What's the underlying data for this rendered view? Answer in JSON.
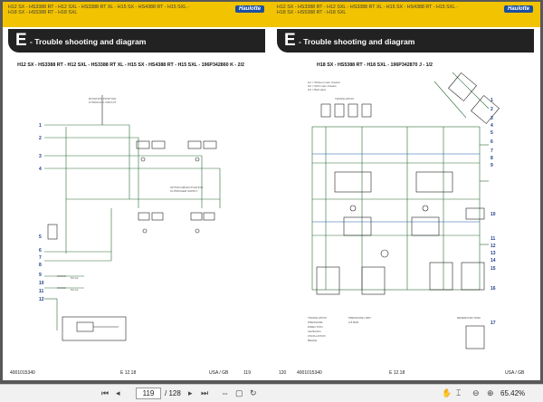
{
  "left_page": {
    "header_lines": [
      "H12 SX - HS3388 RT - H12 SXL - HS3388 RT XL - H15 SX - HS4388 RT - H15 SXL -",
      "H18 SX - HS5388 RT - H18 SXL"
    ],
    "logo": "Haulotte",
    "title_letter": "E",
    "title_text": "- Trouble shooting and diagram",
    "diagram_title": "H12 SX - HS3388 RT - H12 SXL - HS3388 RT XL - H15 SX - HS4388 RT - H15 SXL - 196P342860 K - 2/2",
    "row_numbers": [
      "1",
      "2",
      "3",
      "4",
      "5",
      "6",
      "7",
      "8",
      "9",
      "10",
      "11",
      "12"
    ],
    "footer": {
      "doc_number": "4001015340",
      "edition": "E 12.18",
      "lang": "USA / GB",
      "page": "119"
    }
  },
  "right_page": {
    "header_lines": [
      "H12 SX - HS3388 RT - H12 SXL - HS3388 RT XL - H15 SX - HS4388 RT - H15 SXL -",
      "H18 SX - HS5388 RT - H18 SXL"
    ],
    "logo": "Haulotte",
    "title_letter": "E",
    "title_text": "- Trouble shooting and diagram",
    "diagram_title": "H18 SX - HS5388 RT - H18 SXL - 196P342870 J - 1/2",
    "row_numbers": [
      "1",
      "2",
      "3",
      "4",
      "5",
      "6",
      "7",
      "8",
      "9",
      "10",
      "11",
      "12",
      "13",
      "14",
      "15",
      "16",
      "17"
    ],
    "footer": {
      "page": "120",
      "doc_number": "4001015340",
      "edition": "E 12.18",
      "lang": "USA / GB"
    }
  },
  "toolbar": {
    "current_page": "119",
    "total_pages": "/ 128",
    "zoom": "65.42%",
    "icons": [
      "save-icon",
      "first-page-icon",
      "prev-page-icon",
      "next-page-icon",
      "last-page-icon",
      "fit-width-icon",
      "fit-page-icon",
      "select-icon",
      "hand-icon",
      "zoom-out-icon",
      "zoom-in-icon"
    ]
  }
}
